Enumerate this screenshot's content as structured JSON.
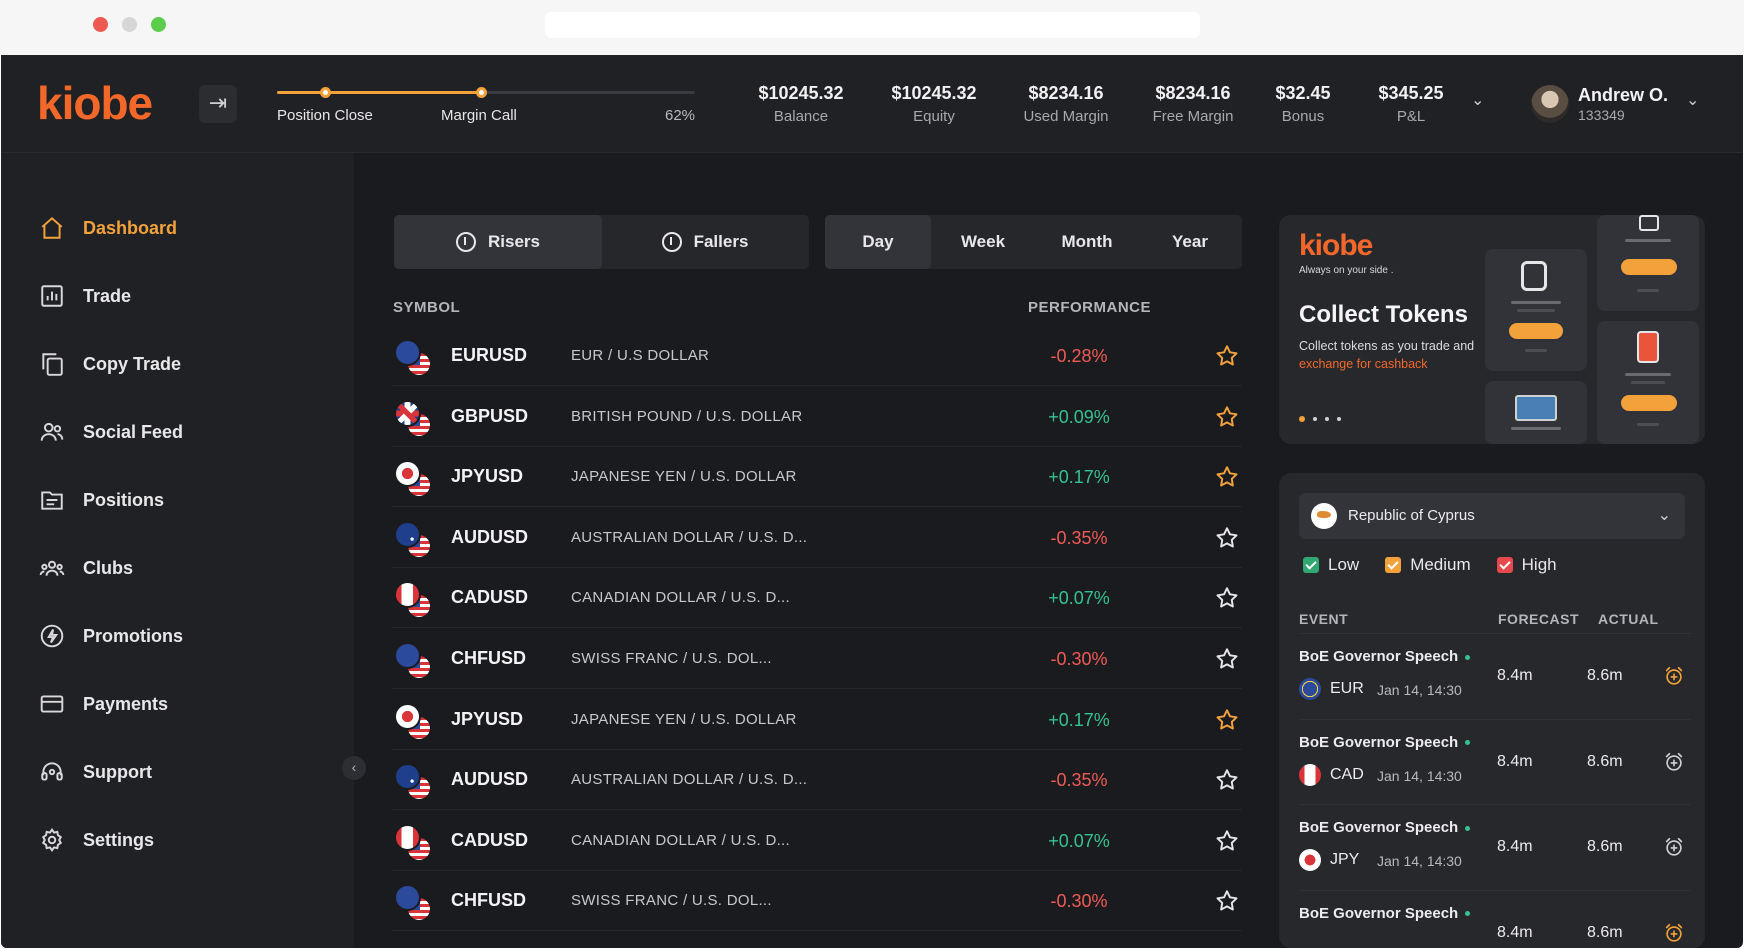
{
  "app": {
    "logo": "kiobe"
  },
  "margin_meter": {
    "position_close_label": "Position Close",
    "margin_call_label": "Margin Call",
    "percent_label": "62%",
    "level": 0.49,
    "accent": "#f3a23b"
  },
  "stats": [
    {
      "value": "$10245.32",
      "label": "Balance"
    },
    {
      "value": "$10245.32",
      "label": "Equity"
    },
    {
      "value": "$8234.16",
      "label": "Used Margin"
    },
    {
      "value": "$8234.16",
      "label": "Free Margin"
    },
    {
      "value": "$32.45",
      "label": "Bonus"
    },
    {
      "value": "$345.25",
      "label": "P&L"
    }
  ],
  "user": {
    "name": "Andrew O.",
    "id": "133349"
  },
  "sidebar": {
    "items": [
      {
        "label": "Dashboard",
        "icon": "home-icon",
        "active": true
      },
      {
        "label": "Trade",
        "icon": "chart-icon"
      },
      {
        "label": "Copy Trade",
        "icon": "copy-icon"
      },
      {
        "label": "Social Feed",
        "icon": "users-icon"
      },
      {
        "label": "Positions",
        "icon": "folder-icon"
      },
      {
        "label": "Clubs",
        "icon": "group-icon"
      },
      {
        "label": "Promotions",
        "icon": "lightning-icon"
      },
      {
        "label": "Payments",
        "icon": "card-icon"
      },
      {
        "label": "Support",
        "icon": "headset-icon"
      },
      {
        "label": "Settings",
        "icon": "gear-icon"
      }
    ]
  },
  "market": {
    "direction_tabs": [
      {
        "label": "Risers",
        "active": true
      },
      {
        "label": "Fallers",
        "active": false
      }
    ],
    "period_tabs": [
      {
        "label": "Day",
        "active": true
      },
      {
        "label": "Week",
        "active": false
      },
      {
        "label": "Month",
        "active": false
      },
      {
        "label": "Year",
        "active": false
      }
    ],
    "columns": {
      "symbol": "SYMBOL",
      "performance": "PERFORMANCE"
    },
    "rows": [
      {
        "symbol": "EURUSD",
        "name": "EUR / U.S DOLLAR",
        "performance": "-0.28%",
        "positive": false,
        "favorite": true,
        "flag": "eu"
      },
      {
        "symbol": "GBPUSD",
        "name": "BRITISH POUND / U.S. DOLLAR",
        "performance": "+0.09%",
        "positive": true,
        "favorite": true,
        "flag": "gb"
      },
      {
        "symbol": "JPYUSD",
        "name": "JAPANESE YEN / U.S. DOLLAR",
        "performance": "+0.17%",
        "positive": true,
        "favorite": true,
        "flag": "jp"
      },
      {
        "symbol": "AUDUSD",
        "name": "AUSTRALIAN DOLLAR / U.S. D...",
        "performance": "-0.35%",
        "positive": false,
        "favorite": false,
        "flag": "au"
      },
      {
        "symbol": "CADUSD",
        "name": "CANADIAN DOLLAR / U.S. D...",
        "performance": "+0.07%",
        "positive": true,
        "favorite": false,
        "flag": "ca"
      },
      {
        "symbol": "CHFUSD",
        "name": "SWISS FRANC / U.S. DOL...",
        "performance": "-0.30%",
        "positive": false,
        "favorite": false,
        "flag": "eu"
      },
      {
        "symbol": "JPYUSD",
        "name": "JAPANESE YEN / U.S. DOLLAR",
        "performance": "+0.17%",
        "positive": true,
        "favorite": true,
        "flag": "jp"
      },
      {
        "symbol": "AUDUSD",
        "name": "AUSTRALIAN DOLLAR / U.S. D...",
        "performance": "-0.35%",
        "positive": false,
        "favorite": false,
        "flag": "au"
      },
      {
        "symbol": "CADUSD",
        "name": "CANADIAN DOLLAR / U.S. D...",
        "performance": "+0.07%",
        "positive": true,
        "favorite": false,
        "flag": "ca"
      },
      {
        "symbol": "CHFUSD",
        "name": "SWISS FRANC / U.S. DOL...",
        "performance": "-0.30%",
        "positive": false,
        "favorite": false,
        "flag": "eu"
      }
    ]
  },
  "promo": {
    "logo": "kiobe",
    "tagline": "Always on your side .",
    "title": "Collect Tokens",
    "text": "Collect tokens as you trade and",
    "highlight": "exchange for cashback"
  },
  "calendar": {
    "country": "Republic of Cyprus",
    "filters": [
      {
        "label": "Low",
        "color": "#2fa872"
      },
      {
        "label": "Medium",
        "color": "#f3a23b"
      },
      {
        "label": "High",
        "color": "#e5484d"
      }
    ],
    "columns": {
      "event": "EVENT",
      "forecast": "FORECAST",
      "actual": "ACTUAL"
    },
    "events": [
      {
        "title": "BoE Governor Speech",
        "currency": "EUR",
        "time": "Jan 14, 14:30",
        "forecast": "8.4m",
        "actual": "8.6m",
        "alarm_active": true,
        "flag": "eu"
      },
      {
        "title": "BoE Governor Speech",
        "currency": "CAD",
        "time": "Jan 14, 14:30",
        "forecast": "8.4m",
        "actual": "8.6m",
        "alarm_active": false,
        "flag": "ca"
      },
      {
        "title": "BoE Governor Speech",
        "currency": "JPY",
        "time": "Jan 14, 14:30",
        "forecast": "8.4m",
        "actual": "8.6m",
        "alarm_active": false,
        "flag": "jp"
      },
      {
        "title": "BoE Governor Speech",
        "currency": "",
        "time": "",
        "forecast": "8.4m",
        "actual": "8.6m",
        "alarm_active": true,
        "flag": ""
      }
    ]
  }
}
